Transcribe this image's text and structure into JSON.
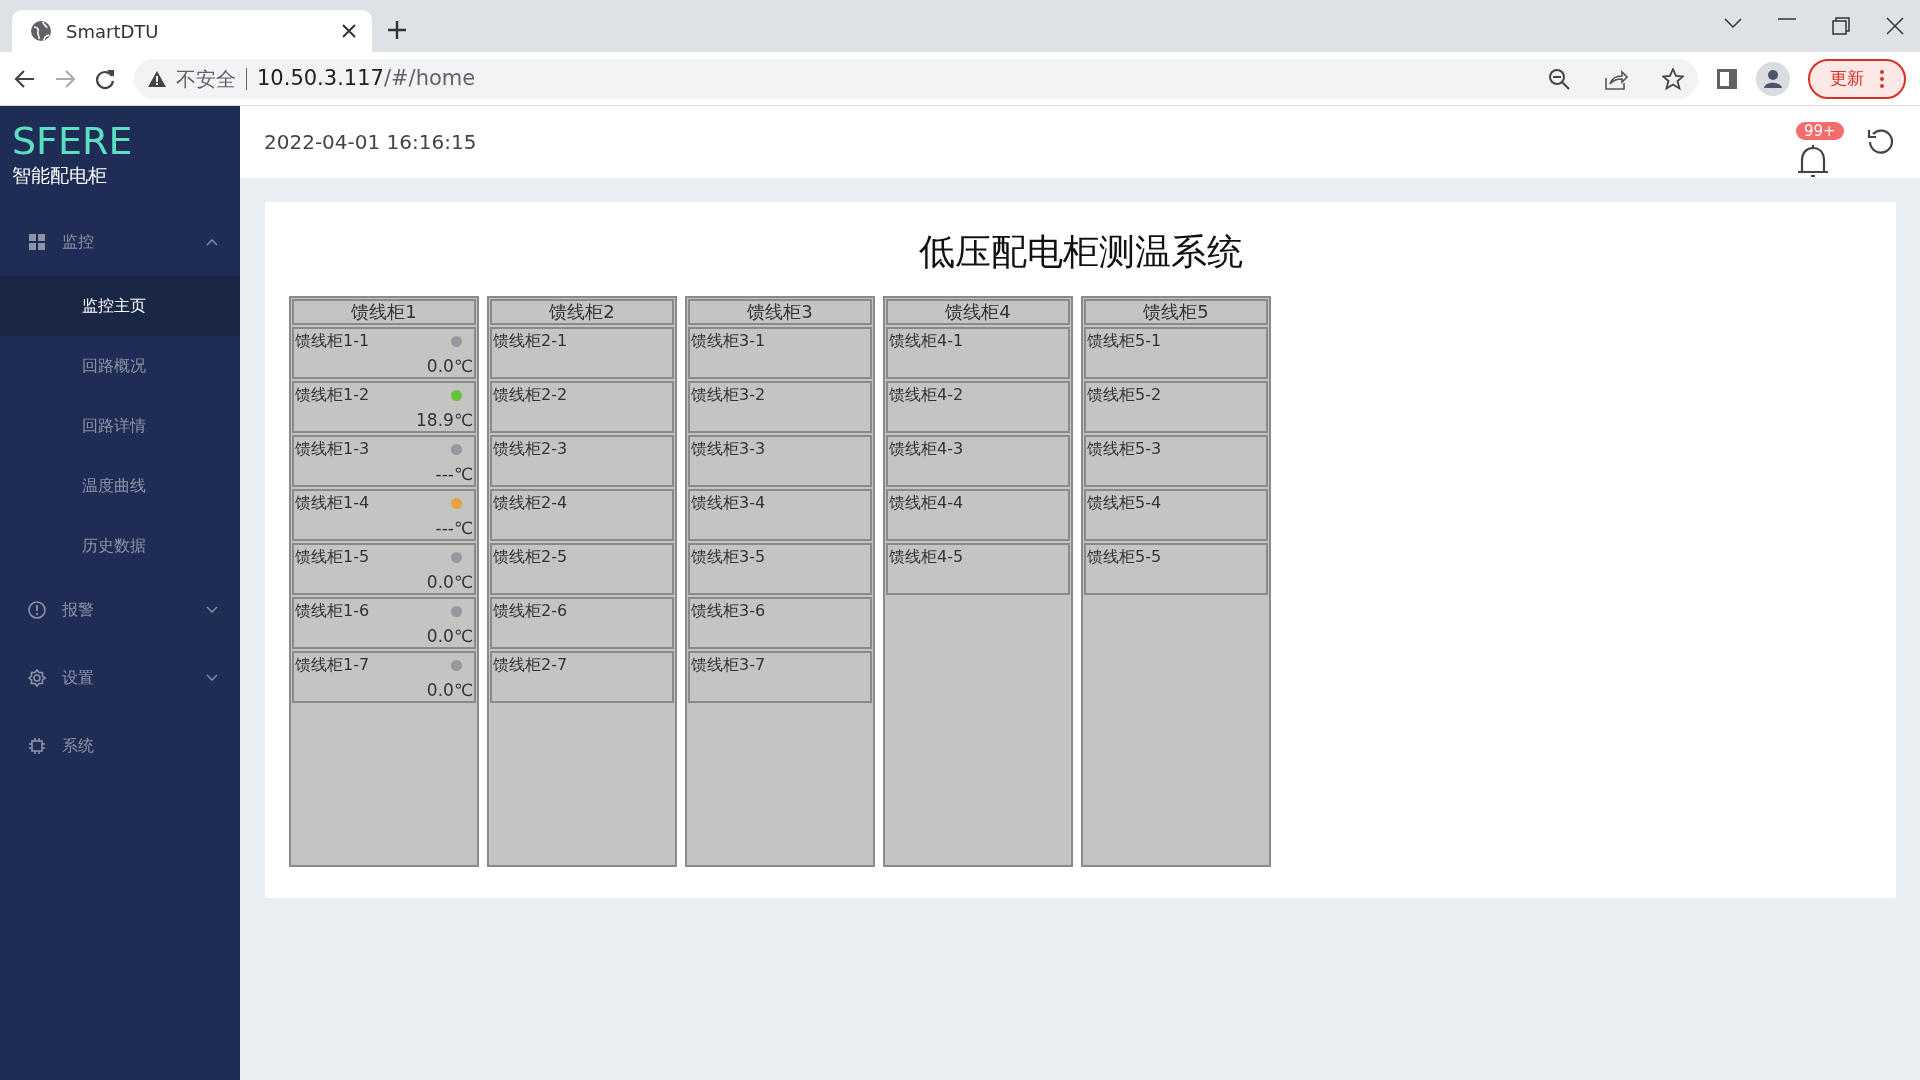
{
  "browser": {
    "tab_title": "SmartDTU",
    "security": "不安全",
    "url_host": "10.50.3.117",
    "url_path": "/#/home",
    "update_button": "更新"
  },
  "sidebar": {
    "logo": "SFERE",
    "subtitle": "智能配电柜",
    "menu": [
      {
        "kind": "grid",
        "label": "监控",
        "expanded": true,
        "children": [
          {
            "label": "监控主页",
            "selected": true
          },
          {
            "label": "回路概况",
            "selected": false
          },
          {
            "label": "回路详情",
            "selected": false
          },
          {
            "label": "温度曲线",
            "selected": false
          },
          {
            "label": "历史数据",
            "selected": false
          }
        ]
      },
      {
        "kind": "alert",
        "label": "报警",
        "expanded": false
      },
      {
        "kind": "gear",
        "label": "设置",
        "expanded": false
      },
      {
        "kind": "chip",
        "label": "系统"
      }
    ]
  },
  "header": {
    "datetime": "2022-04-01 16:16:15",
    "notification_badge": "99+"
  },
  "main": {
    "title": "低压配电柜测温系统",
    "cabinets": [
      {
        "name": "馈线柜1",
        "circuits": [
          {
            "name": "馈线柜1-1",
            "color": "#97979f",
            "reading": "0.0℃"
          },
          {
            "name": "馈线柜1-2",
            "color": "#67c23a",
            "reading": "18.9℃"
          },
          {
            "name": "馈线柜1-3",
            "color": "#97979f",
            "reading": "---℃"
          },
          {
            "name": "馈线柜1-4",
            "color": "#e6a23c",
            "reading": "---℃"
          },
          {
            "name": "馈线柜1-5",
            "color": "#97979f",
            "reading": "0.0℃"
          },
          {
            "name": "馈线柜1-6",
            "color": "#97979f",
            "reading": "0.0℃"
          },
          {
            "name": "馈线柜1-7",
            "color": "#97979f",
            "reading": "0.0℃"
          }
        ]
      },
      {
        "name": "馈线柜2",
        "circuits": [
          {
            "name": "馈线柜2-1"
          },
          {
            "name": "馈线柜2-2"
          },
          {
            "name": "馈线柜2-3"
          },
          {
            "name": "馈线柜2-4"
          },
          {
            "name": "馈线柜2-5"
          },
          {
            "name": "馈线柜2-6"
          },
          {
            "name": "馈线柜2-7"
          }
        ]
      },
      {
        "name": "馈线柜3",
        "circuits": [
          {
            "name": "馈线柜3-1"
          },
          {
            "name": "馈线柜3-2"
          },
          {
            "name": "馈线柜3-3"
          },
          {
            "name": "馈线柜3-4"
          },
          {
            "name": "馈线柜3-5"
          },
          {
            "name": "馈线柜3-6"
          },
          {
            "name": "馈线柜3-7"
          }
        ]
      },
      {
        "name": "馈线柜4",
        "circuits": [
          {
            "name": "馈线柜4-1"
          },
          {
            "name": "馈线柜4-2"
          },
          {
            "name": "馈线柜4-3"
          },
          {
            "name": "馈线柜4-4"
          },
          {
            "name": "馈线柜4-5"
          }
        ]
      },
      {
        "name": "馈线柜5",
        "circuits": [
          {
            "name": "馈线柜5-1"
          },
          {
            "name": "馈线柜5-2"
          },
          {
            "name": "馈线柜5-3"
          },
          {
            "name": "馈线柜5-4"
          },
          {
            "name": "馈线柜5-5"
          }
        ]
      }
    ]
  }
}
